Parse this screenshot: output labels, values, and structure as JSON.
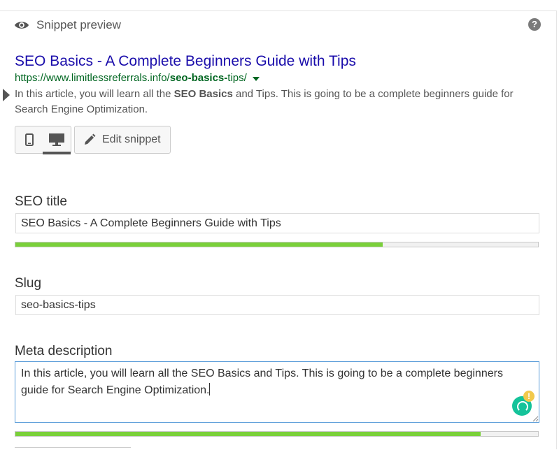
{
  "header": {
    "title": "Snippet preview",
    "help": "?"
  },
  "snippet": {
    "title": "SEO Basics - A Complete Beginners Guide with Tips",
    "url_base": "https://www.limitlessreferrals.info/",
    "url_bold": "seo-basics-",
    "url_rest": "tips/",
    "desc_1": "In this article, you will learn all the ",
    "desc_bold": "SEO Basics",
    "desc_2": " and Tips. This is going to be a complete beginners guide for Search Engine Optimization."
  },
  "toolbar": {
    "edit_label": "Edit snippet",
    "active_mode": "desktop"
  },
  "seo_title": {
    "label": "SEO title",
    "value": "SEO Basics - A Complete Beginners Guide with Tips",
    "progress": 0.703
  },
  "slug": {
    "label": "Slug",
    "value": "seo-basics-tips"
  },
  "meta": {
    "label": "Meta description",
    "value": "In this article, you will learn all the SEO Basics and Tips. This is going to be a complete beginners guide for Search Engine Optimization.",
    "progress": 0.89
  },
  "colors": {
    "title_link": "#1a0dab",
    "url": "#006621",
    "progress_good": "#7ad03a",
    "focus_border": "#5b9dd9",
    "grammarly": "#15c39a"
  }
}
